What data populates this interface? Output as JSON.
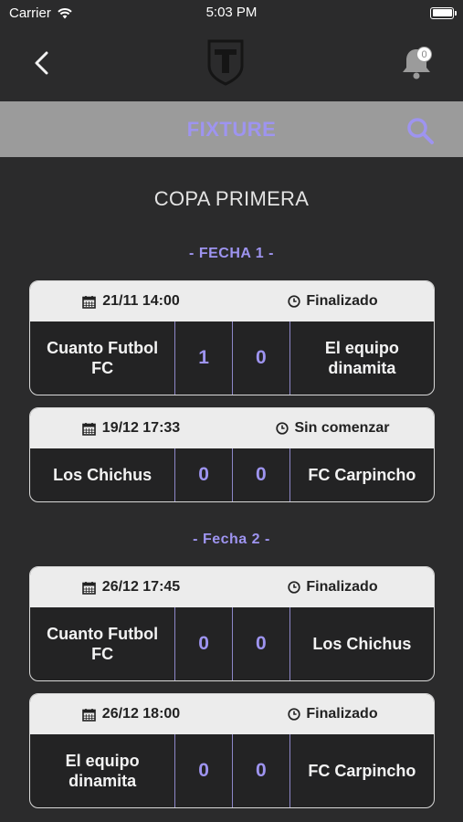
{
  "status_bar": {
    "carrier": "Carrier",
    "time": "5:03 PM"
  },
  "nav": {
    "notification_count": "0"
  },
  "banner": {
    "title": "FIXTURE"
  },
  "tournament": "COPA PRIMERA",
  "rounds": [
    {
      "title": "- FECHA 1 -",
      "matches": [
        {
          "date": "21/11 14:00",
          "status": "Finalizado",
          "home": "Cuanto Futbol FC",
          "home_score": "1",
          "away_score": "0",
          "away": "El equipo dinamita"
        },
        {
          "date": "19/12 17:33",
          "status": "Sin comenzar",
          "home": "Los Chichus",
          "home_score": "0",
          "away_score": "0",
          "away": "FC Carpincho"
        }
      ]
    },
    {
      "title": "- Fecha 2 -",
      "matches": [
        {
          "date": "26/12 17:45",
          "status": "Finalizado",
          "home": "Cuanto Futbol FC",
          "home_score": "0",
          "away_score": "0",
          "away": "Los Chichus"
        },
        {
          "date": "26/12 18:00",
          "status": "Finalizado",
          "home": "El equipo dinamita",
          "home_score": "0",
          "away_score": "0",
          "away": "FC Carpincho"
        }
      ]
    }
  ],
  "colors": {
    "accent": "#9e94f0",
    "background": "#2b2b2c",
    "banner": "#9b9b9b",
    "card_header": "#ececec"
  },
  "icons": [
    "wifi-icon",
    "battery-icon",
    "back-arrow-icon",
    "club-logo",
    "bell-icon",
    "search-icon",
    "calendar-icon",
    "clock-icon"
  ]
}
